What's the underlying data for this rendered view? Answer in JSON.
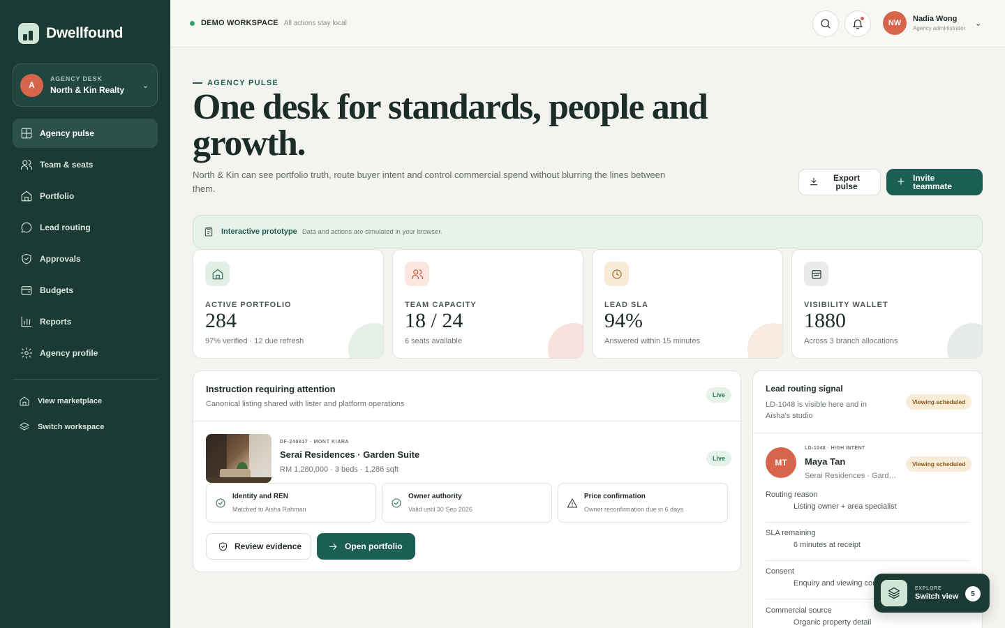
{
  "brand": {
    "name": "Dwellfound"
  },
  "agency": {
    "avatar": "A",
    "label": "AGENCY DESK",
    "name": "North & Kin Realty"
  },
  "nav": [
    {
      "label": "Agency pulse",
      "icon": "grid-icon",
      "active": true
    },
    {
      "label": "Team & seats",
      "icon": "users-icon"
    },
    {
      "label": "Portfolio",
      "icon": "home-icon"
    },
    {
      "label": "Lead routing",
      "icon": "chat-icon"
    },
    {
      "label": "Approvals",
      "icon": "shield-check-icon"
    },
    {
      "label": "Budgets",
      "icon": "wallet-icon"
    },
    {
      "label": "Reports",
      "icon": "bar-chart-icon"
    },
    {
      "label": "Agency profile",
      "icon": "gear-icon"
    }
  ],
  "nav_secondary": [
    {
      "label": "View marketplace",
      "icon": "home-icon"
    },
    {
      "label": "Switch workspace",
      "icon": "layers-icon"
    }
  ],
  "topbar": {
    "workspace": "DEMO WORKSPACE",
    "workspace_note": "All actions stay local",
    "user": {
      "initials": "NW",
      "name": "Nadia Wong",
      "role": "Agency administrator"
    }
  },
  "hero": {
    "kicker": "AGENCY PULSE",
    "headline": "One desk for standards, people and growth.",
    "subline": "North & Kin can see portfolio truth, route buyer intent and control commercial spend without blurring the lines between them.",
    "export_label": "Export pulse",
    "invite_label": "Invite teammate"
  },
  "prototype": {
    "title": "Interactive prototype",
    "note": "Data and actions are simulated in your browser."
  },
  "stats": [
    {
      "label": "ACTIVE PORTFOLIO",
      "value": "284",
      "note": "97% verified · 12 due refresh",
      "icon": "home-icon"
    },
    {
      "label": "TEAM CAPACITY",
      "value": "18 / 24",
      "note": "6 seats available",
      "icon": "users-icon"
    },
    {
      "label": "LEAD SLA",
      "value": "94%",
      "note": "Answered within 15 minutes",
      "icon": "clock-icon"
    },
    {
      "label": "VISIBILITY WALLET",
      "value": "1880",
      "note": "Across 3 branch allocations",
      "icon": "wallet-icon"
    }
  ],
  "instruction": {
    "title": "Instruction requiring attention",
    "subtitle": "Canonical listing shared with lister and platform operations",
    "status": "Live",
    "listing": {
      "ref": "DF-240817 · MONT KIARA",
      "name": "Serai Residences · Garden Suite",
      "meta": "RM 1,280,000 · 3 beds · 1,286 sqft",
      "status": "Live"
    },
    "checks": [
      {
        "title": "Identity and REN",
        "note": "Matched to Aisha Rahman",
        "icon": "check-circle-icon"
      },
      {
        "title": "Owner authority",
        "note": "Valid until 30 Sep 2026",
        "icon": "check-circle-icon"
      },
      {
        "title": "Price confirmation",
        "note": "Owner reconfirmation due in 6 days",
        "icon": "warning-icon"
      }
    ],
    "review_label": "Review evidence",
    "open_label": "Open portfolio"
  },
  "lead": {
    "title": "Lead routing signal",
    "subtitle": "LD-1048 is visible here and in Aisha's studio",
    "status": "Viewing scheduled",
    "contact": {
      "initials": "MT",
      "ref": "LD-1048 · HIGH INTENT",
      "name": "Maya Tan",
      "property": "Serai Residences · Garden Suite",
      "status": "Viewing scheduled"
    },
    "rows": [
      {
        "k": "Routing reason",
        "v": "Listing owner + area specialist"
      },
      {
        "k": "SLA remaining",
        "v": "6 minutes at receipt"
      },
      {
        "k": "Consent",
        "v": "Enquiry and viewing contact"
      },
      {
        "k": "Commercial source",
        "v": "Organic property detail"
      }
    ]
  },
  "switch_view": {
    "kicker": "EXPLORE",
    "label": "Switch view",
    "count": "5"
  },
  "colors": {
    "sidebar": "#1b3a33",
    "accent": "#1b5e53",
    "coral": "#d7654c",
    "background": "#f3f3ef"
  }
}
